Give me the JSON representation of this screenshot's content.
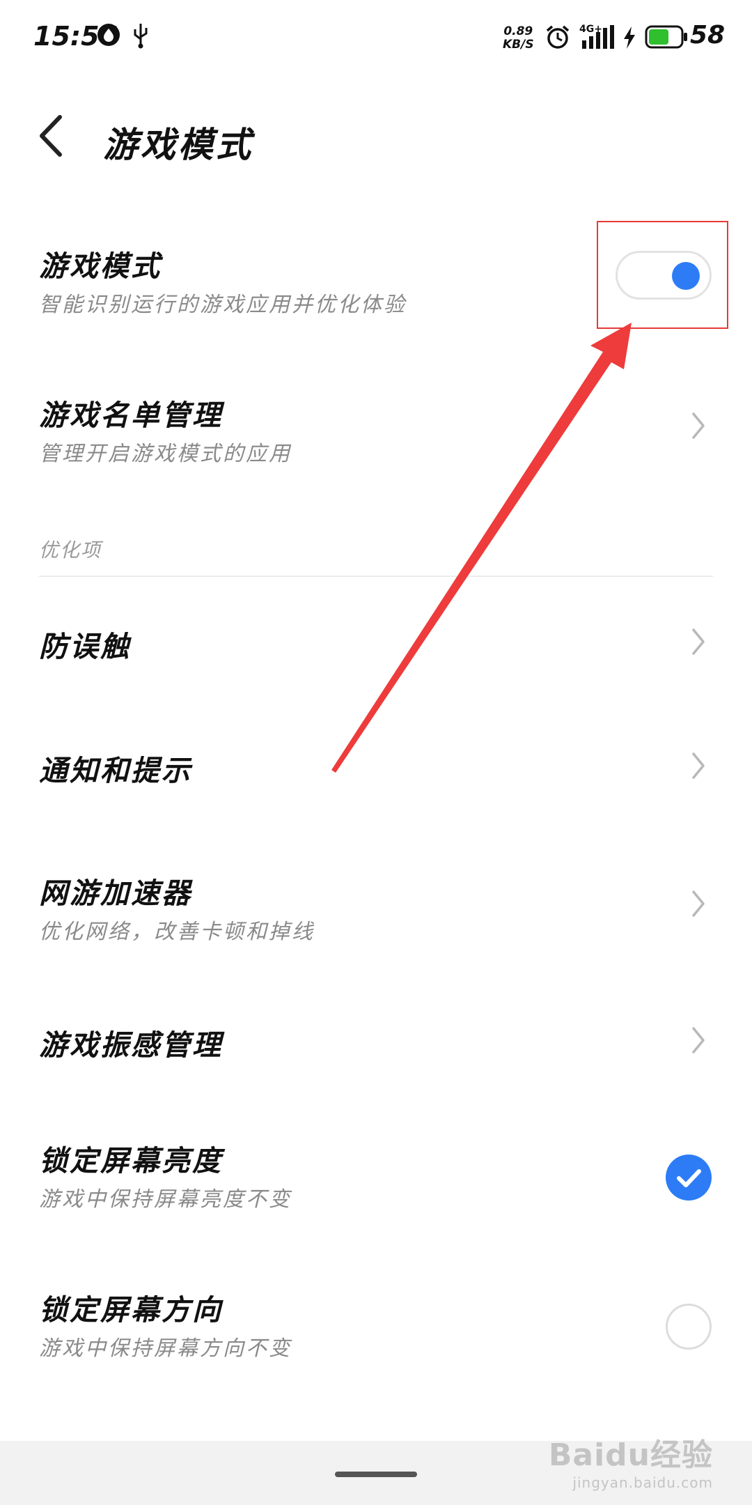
{
  "status_bar": {
    "time": "15:56",
    "net_speed_value": "0.89",
    "net_speed_unit": "KB/S",
    "network_type": "4G+",
    "battery_level": "58",
    "icons": [
      "notification-badge-icon",
      "usb-icon",
      "alarm-icon",
      "signal-icon",
      "charging-icon",
      "battery-icon"
    ]
  },
  "header": {
    "title": "游戏模式",
    "back_icon": "chevron-left-icon"
  },
  "settings": {
    "game_mode": {
      "title": "游戏模式",
      "subtitle": "智能识别运行的游戏应用并优化体验",
      "enabled": true
    },
    "game_list": {
      "title": "游戏名单管理",
      "subtitle": "管理开启游戏模式的应用"
    },
    "section_label": "优化项",
    "anti_touch": {
      "title": "防误触"
    },
    "notifications": {
      "title": "通知和提示"
    },
    "accelerator": {
      "title": "网游加速器",
      "subtitle": "优化网络，改善卡顿和掉线"
    },
    "vibration": {
      "title": "游戏振感管理"
    },
    "lock_brightness": {
      "title": "锁定屏幕亮度",
      "subtitle": "游戏中保持屏幕亮度不变",
      "checked": true
    },
    "lock_orientation": {
      "title": "锁定屏幕方向",
      "subtitle": "游戏中保持屏幕方向不变",
      "checked": false
    }
  },
  "watermark": {
    "brand": "Baidu经验",
    "domain": "jingyan.baidu.com"
  },
  "colors": {
    "accent": "#2d7cf6",
    "annotation": "#e53935"
  }
}
